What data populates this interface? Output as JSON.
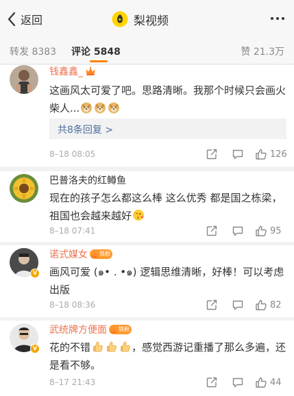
{
  "nav": {
    "back_label": "返回",
    "title": "梨视频"
  },
  "tabs": {
    "repost_label": "转发",
    "repost_count": "8383",
    "comment_label": "评论",
    "comment_count": "5848",
    "like_label": "赞",
    "like_count": "21.3万"
  },
  "colors": {
    "accent": "#ff8200",
    "vip_name": "#eb7350",
    "reply_link": "#4e6ea1",
    "fan_badge": "#ff9a2e",
    "logo_yellow": "#ffd400"
  },
  "comments": [
    {
      "name": "钱鑫鑫_",
      "text": "这画风太可爱了吧。思路清晰。我那个时候只会画火柴人...",
      "emoji": [
        "doge",
        "doge",
        "doge"
      ],
      "replies": "共8条回复 >",
      "time": "8–18 08:05",
      "likes": "126"
    },
    {
      "name": "巴普洛夫的红鳟鱼",
      "text": "现在的孩子怎么都这么棒 这么优秀  都是国之栋梁，祖国也会越来越好",
      "emoji": [
        "kiss"
      ],
      "time": "8–18 07:41",
      "likes": "95"
    },
    {
      "name": "诺式媒女",
      "fan_label": "铁粉",
      "text": "画风可爱 (๑• . •๑) 逻辑思维清晰，好棒！可以考虑出版",
      "time": "8–18 08:36",
      "likes": "82"
    },
    {
      "name": "武统牌方便面",
      "fan_label": "铁粉",
      "text_pre": "花的不错",
      "text_post": "，感觉西游记重播了那么多遍，还是看不够。",
      "emoji": [
        "thumb",
        "thumb",
        "thumb"
      ],
      "time": "8–17 21:43",
      "likes": "44"
    }
  ],
  "icons": {
    "back": "chevron-left-icon",
    "logo": "pearvideo-logo-icon",
    "more": "more-dots-icon",
    "share": "share-icon",
    "reply": "comment-icon",
    "like": "thumbs-up-icon"
  }
}
